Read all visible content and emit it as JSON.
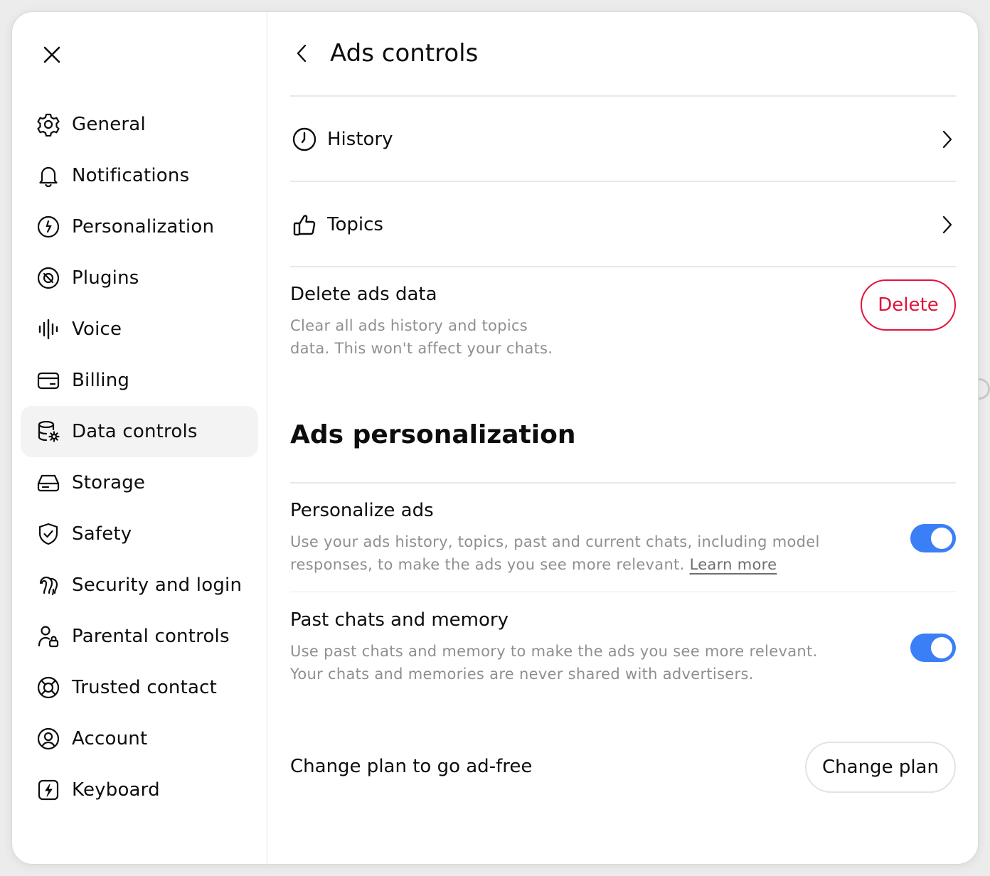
{
  "colors": {
    "accent_toggle": "#3a7ff6",
    "danger": "#e0143c",
    "muted_text": "#8f8f8f",
    "active_nav_bg": "#f3f3f3"
  },
  "sidebar": {
    "close_icon": "close-icon",
    "items": [
      {
        "label": "General",
        "icon": "gear-icon"
      },
      {
        "label": "Notifications",
        "icon": "bell-icon"
      },
      {
        "label": "Personalization",
        "icon": "personalization-icon"
      },
      {
        "label": "Plugins",
        "icon": "plugins-icon"
      },
      {
        "label": "Voice",
        "icon": "voice-waveform-icon"
      },
      {
        "label": "Billing",
        "icon": "card-icon"
      },
      {
        "label": "Data controls",
        "icon": "database-gear-icon",
        "active": true
      },
      {
        "label": "Storage",
        "icon": "storage-drive-icon"
      },
      {
        "label": "Safety",
        "icon": "shield-check-icon"
      },
      {
        "label": "Security and login",
        "icon": "security-login-icon"
      },
      {
        "label": "Parental controls",
        "icon": "person-lock-icon"
      },
      {
        "label": "Trusted contact",
        "icon": "lifebuoy-icon"
      },
      {
        "label": "Account",
        "icon": "account-circle-icon"
      },
      {
        "label": "Keyboard",
        "icon": "keyboard-bolt-icon"
      }
    ]
  },
  "header": {
    "title": "Ads controls",
    "back_icon": "chevron-left-icon"
  },
  "links": {
    "history": {
      "label": "History",
      "icon": "clock-icon"
    },
    "topics": {
      "label": "Topics",
      "icon": "thumbs-up-icon"
    }
  },
  "delete_ads": {
    "title": "Delete ads data",
    "desc_line1": "Clear all ads history and topics",
    "desc_line2": "data. This won't affect your chats.",
    "button": "Delete"
  },
  "personalization": {
    "section_title": "Ads personalization",
    "personalize_ads": {
      "title": "Personalize ads",
      "desc_line1": "Use your ads history, topics, past and current chats, including model",
      "desc_line2": "responses, to make the ads you see more relevant.",
      "link": "Learn more",
      "enabled": true
    },
    "past_chats": {
      "title": "Past chats and memory",
      "desc_line1": "Use past chats and memory to make the ads you see more relevant.",
      "desc_line2": "Your chats and memories are never shared with advertisers.",
      "enabled": true
    }
  },
  "plan": {
    "label": "Change plan to go ad-free",
    "button": "Change plan"
  }
}
